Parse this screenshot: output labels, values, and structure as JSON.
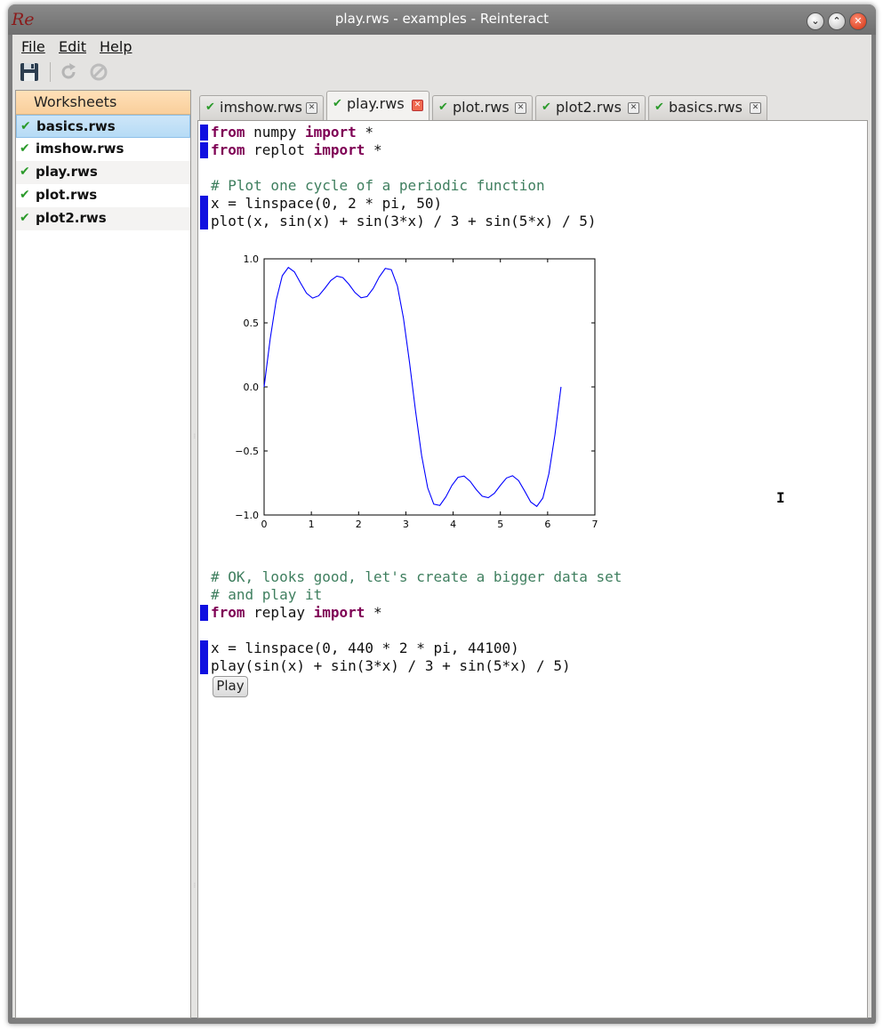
{
  "window": {
    "title": "play.rws - examples - Reinteract",
    "logo": "Re",
    "buttons": [
      "minimize",
      "maximize",
      "close"
    ]
  },
  "menu": {
    "file": "File",
    "edit": "Edit",
    "help": "Help"
  },
  "toolbar": {
    "icons": [
      "save-icon",
      "refresh-icon",
      "stop-icon"
    ]
  },
  "sidebar": {
    "header": "Worksheets",
    "items": [
      {
        "label": "basics.rws",
        "selected": true
      },
      {
        "label": "imshow.rws",
        "selected": false
      },
      {
        "label": "play.rws",
        "selected": false
      },
      {
        "label": "plot.rws",
        "selected": false
      },
      {
        "label": "plot2.rws",
        "selected": false
      }
    ]
  },
  "tabs": [
    {
      "label": "imshow.rws",
      "active": false
    },
    {
      "label": "play.rws",
      "active": true
    },
    {
      "label": "plot.rws",
      "active": false
    },
    {
      "label": "plot2.rws",
      "active": false
    },
    {
      "label": "basics.rws",
      "active": false
    }
  ],
  "code": {
    "l1": {
      "kw1": "from",
      "mid": " numpy ",
      "kw2": "import",
      "rest": " *"
    },
    "l2": {
      "kw1": "from",
      "mid": " replot ",
      "kw2": "import",
      "rest": " *"
    },
    "c1": "# Plot one cycle of a periodic function",
    "l3": "x = linspace(0, 2 * pi, 50)",
    "l4": "plot(x, sin(x) + sin(3*x) / 3 + sin(5*x) / 5)",
    "c2": "# OK, looks good, let's create a bigger data set",
    "c3": "# and play it",
    "l5": {
      "kw1": "from",
      "mid": " replay ",
      "kw2": "import",
      "rest": " *"
    },
    "l6": "x = linspace(0, 440 * 2 * pi, 44100)",
    "l7": "play(sin(x) + sin(3*x) / 3 + sin(5*x) / 5)"
  },
  "play_button": "Play",
  "chart_data": {
    "type": "line",
    "title": "",
    "xlabel": "",
    "ylabel": "",
    "xlim": [
      0,
      7
    ],
    "ylim": [
      -1.0,
      1.0
    ],
    "x_ticks": [
      "0",
      "1",
      "2",
      "3",
      "4",
      "5",
      "6",
      "7"
    ],
    "y_ticks": [
      "−1.0",
      "−0.5",
      "0.0",
      "0.5",
      "1.0"
    ],
    "series": [
      {
        "function": "sin(x) + sin(3*x)/3 + sin(5*x)/5",
        "x_range": [
          0,
          6.2832
        ],
        "points": 50,
        "color": "#0000ff"
      }
    ]
  }
}
